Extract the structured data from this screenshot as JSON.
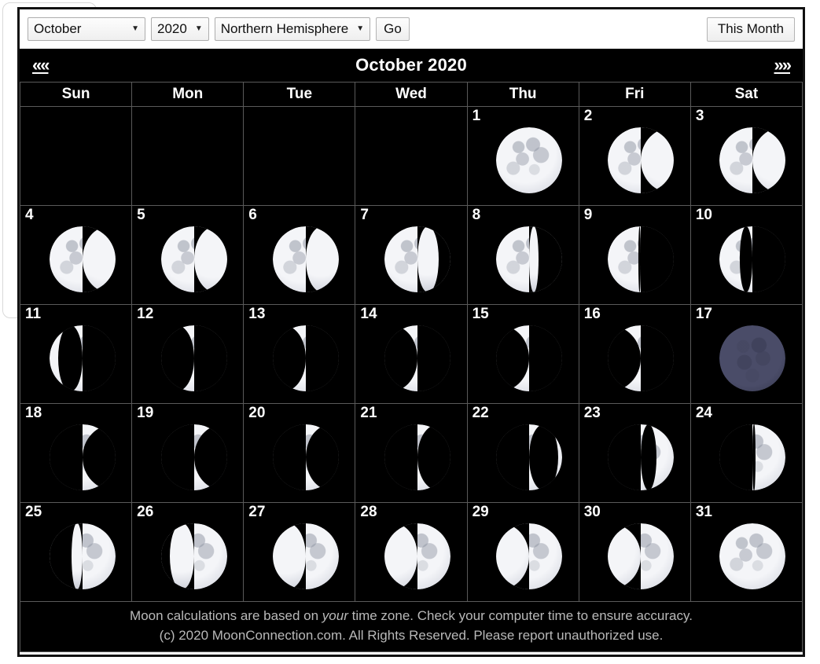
{
  "toolbar": {
    "month_select": "October",
    "year_select": "2020",
    "hemisphere_select": "Northern Hemisphere",
    "go_label": "Go",
    "this_month_label": "This Month"
  },
  "calendar": {
    "title": "October 2020",
    "prev_label": "««",
    "next_label": "»»",
    "weekdays": [
      "Sun",
      "Mon",
      "Tue",
      "Wed",
      "Thu",
      "Fri",
      "Sat"
    ],
    "today_weekday": "Thu",
    "today_day": 1,
    "days": [
      {
        "n": "",
        "phase": "",
        "illum": 0
      },
      {
        "n": "",
        "phase": "",
        "illum": 0
      },
      {
        "n": "",
        "phase": "",
        "illum": 0
      },
      {
        "n": "",
        "phase": "",
        "illum": 0
      },
      {
        "n": "1",
        "phase": "full",
        "illum": 100
      },
      {
        "n": "2",
        "phase": "waning-gibbous",
        "illum": 98
      },
      {
        "n": "3",
        "phase": "waning-gibbous",
        "illum": 95
      },
      {
        "n": "4",
        "phase": "waning-gibbous",
        "illum": 90
      },
      {
        "n": "5",
        "phase": "waning-gibbous",
        "illum": 83
      },
      {
        "n": "6",
        "phase": "waning-gibbous",
        "illum": 75
      },
      {
        "n": "7",
        "phase": "waning-gibbous",
        "illum": 66
      },
      {
        "n": "8",
        "phase": "waning-gibbous",
        "illum": 57
      },
      {
        "n": "9",
        "phase": "last-quarter",
        "illum": 48
      },
      {
        "n": "10",
        "phase": "last-quarter",
        "illum": 40
      },
      {
        "n": "11",
        "phase": "waning-crescent",
        "illum": 32
      },
      {
        "n": "12",
        "phase": "waning-crescent",
        "illum": 24
      },
      {
        "n": "13",
        "phase": "waning-crescent",
        "illum": 17
      },
      {
        "n": "14",
        "phase": "waning-crescent",
        "illum": 11
      },
      {
        "n": "15",
        "phase": "waning-crescent",
        "illum": 6
      },
      {
        "n": "16",
        "phase": "waning-crescent",
        "illum": 2
      },
      {
        "n": "17",
        "phase": "new",
        "illum": 0
      },
      {
        "n": "18",
        "phase": "waxing-crescent",
        "illum": 2
      },
      {
        "n": "19",
        "phase": "waxing-crescent",
        "illum": 6
      },
      {
        "n": "20",
        "phase": "waxing-crescent",
        "illum": 12
      },
      {
        "n": "21",
        "phase": "waxing-crescent",
        "illum": 19
      },
      {
        "n": "22",
        "phase": "waxing-crescent",
        "illum": 28
      },
      {
        "n": "23",
        "phase": "waxing-crescent",
        "illum": 38
      },
      {
        "n": "24",
        "phase": "first-quarter",
        "illum": 48
      },
      {
        "n": "25",
        "phase": "waxing-gibbous",
        "illum": 58
      },
      {
        "n": "26",
        "phase": "waxing-gibbous",
        "illum": 68
      },
      {
        "n": "27",
        "phase": "waxing-gibbous",
        "illum": 77
      },
      {
        "n": "28",
        "phase": "waxing-gibbous",
        "illum": 86
      },
      {
        "n": "29",
        "phase": "waxing-gibbous",
        "illum": 93
      },
      {
        "n": "30",
        "phase": "waxing-gibbous",
        "illum": 98
      },
      {
        "n": "31",
        "phase": "full",
        "illum": 100
      }
    ]
  },
  "footer": {
    "line1_before": "Moon calculations are based on ",
    "line1_italic": "your",
    "line1_after": " time zone. Check your computer time to ensure accuracy.",
    "line2": "(c) 2020 MoonConnection.com. All Rights Reserved. Please report unauthorized use."
  },
  "colors": {
    "background": "#000000",
    "text": "#ffffff",
    "grid_line": "#5a5a5a",
    "footer_text": "#b9b9b9",
    "today_border": "#ffffff",
    "new_moon": "#4a4c68"
  }
}
